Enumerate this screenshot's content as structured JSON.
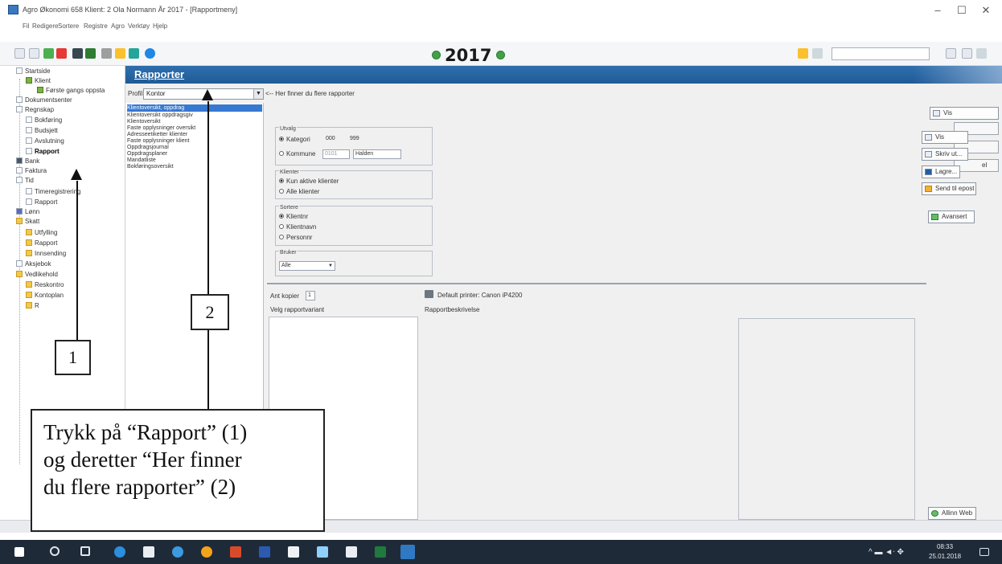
{
  "window": {
    "title": "Agro Økonomi 658     Klient: 2 Ola Normann   År 2017 - [Rapportmeny]",
    "minimize": "–",
    "maximize": "☐",
    "close": "✕"
  },
  "menu": [
    "Fil",
    "Redigere",
    "Sortere",
    "Registre",
    "Agro",
    "Verktøy",
    "Hjelp"
  ],
  "toolbar": {
    "year": "2017"
  },
  "sidebar": {
    "items": [
      {
        "label": "Startside",
        "indent": 0
      },
      {
        "label": "Klient",
        "indent": 1
      },
      {
        "label": "Første gangs oppsta",
        "indent": 2
      },
      {
        "label": "Dokumentsenter",
        "indent": 0
      },
      {
        "label": "Regnskap",
        "indent": 0
      },
      {
        "label": "Bokføring",
        "indent": 1
      },
      {
        "label": "Budsjett",
        "indent": 1
      },
      {
        "label": "Avslutning",
        "indent": 1
      },
      {
        "label": "Rapport",
        "indent": 1
      },
      {
        "label": "Bank",
        "indent": 0
      },
      {
        "label": "Faktura",
        "indent": 0
      },
      {
        "label": "Tid",
        "indent": 0
      },
      {
        "label": "Timeregistrering",
        "indent": 1
      },
      {
        "label": "Rapport",
        "indent": 1
      },
      {
        "label": "Lønn",
        "indent": 0
      },
      {
        "label": "Skatt",
        "indent": 0
      },
      {
        "label": "Utfylling",
        "indent": 1
      },
      {
        "label": "Rapport",
        "indent": 1
      },
      {
        "label": "Innsending",
        "indent": 1
      },
      {
        "label": "Aksjebok",
        "indent": 0
      },
      {
        "label": "Vedlikehold",
        "indent": 0
      },
      {
        "label": "Reskontro",
        "indent": 1
      },
      {
        "label": "Kontoplan",
        "indent": 1
      },
      {
        "label": "R",
        "indent": 1
      }
    ]
  },
  "header": {
    "title": "Rapporter"
  },
  "content": {
    "profile_label": "Profil",
    "profile_value": "Kontor",
    "more_reports_link": "<-- Her finner du flere rapporter",
    "reports": [
      "Klientoversikt, oppdrag",
      "Klientoversikt oppdragsgiv",
      "Klientoversikt",
      "Faste opplysninger oversikt",
      "Adresseetiketter klienter",
      "Faste opplysninger klient",
      "Oppdragsjournal",
      "Oppdragsplaner",
      "Mandatliste",
      "Bokføringsoversikt"
    ],
    "utvalg": {
      "legend": "Utvalg",
      "kategori_label": "Kategori",
      "kategori_from": "000",
      "kategori_to": "999",
      "kommune_label": "Kommune",
      "kommune_code": "0101",
      "kommune_name": "Halden"
    },
    "klienter": {
      "legend": "Klienter",
      "opt1": "Kun aktive klienter",
      "opt2": "Alle klienter"
    },
    "sortere": {
      "legend": "Sortere",
      "opt1": "Klientnr",
      "opt2": "Klientnavn",
      "opt3": "Personnr"
    },
    "bruker": {
      "legend": "Bruker",
      "value": "Alle"
    },
    "copies_label": "Ant kopier",
    "copies_value": "1",
    "default_printer": "Default printer: Canon iP4200",
    "variant_label": "Velg rapportvariant",
    "description_label": "Rapportbeskrivelse"
  },
  "right_buttons": {
    "vis_top": "Vis",
    "vis": "Vis",
    "skriv_ut": "Skriv ut...",
    "lagre": "Lagre...",
    "send_epost": "Send til epost",
    "avansert": "Avansert",
    "partial": "el",
    "allinn_web": "Allinn Web"
  },
  "annotation": {
    "box1": "1",
    "box2": "2",
    "instruction_line1": "Trykk på “Rapport” (1)",
    "instruction_line2": "og deretter “Her finner",
    "instruction_line3": "du flere rapporter” (2)"
  },
  "taskbar": {
    "time": "08:33",
    "date": "25.01.2018"
  },
  "colors": {
    "header_blue": "#2f6fae",
    "selection_blue": "#3778d1",
    "taskbar": "#1f2a38"
  }
}
